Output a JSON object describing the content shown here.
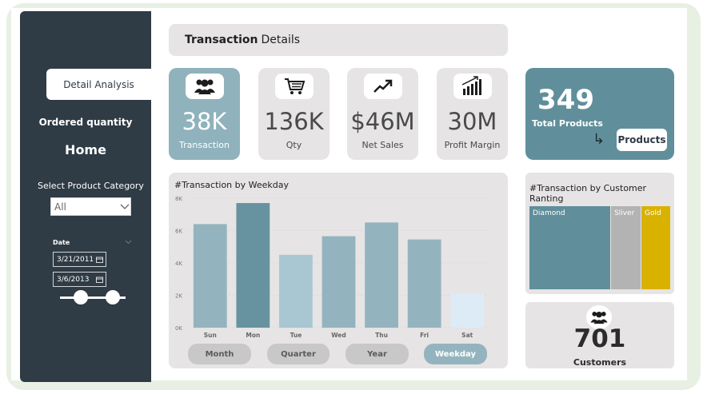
{
  "sidebar": {
    "nav_active": "Detail Analysis",
    "nav_ordered": "Ordered quantity",
    "nav_home": "Home",
    "category_label": "Select Product Category",
    "category_value": "All",
    "date_label": "Date",
    "date_start": "3/21/2011",
    "date_end": "3/6/2013"
  },
  "header": {
    "title_bold": "Transaction",
    "title_rest": "Details"
  },
  "kpis": [
    {
      "value": "38K",
      "label": "Transaction",
      "icon": "people-icon"
    },
    {
      "value": "136K",
      "label": "Qty",
      "icon": "cart-icon"
    },
    {
      "value": "$46M",
      "label": "Net Sales",
      "icon": "trend-up-icon"
    },
    {
      "value": "30M",
      "label": "Profit Margin",
      "icon": "bar-growth-icon"
    }
  ],
  "products": {
    "value": "349",
    "label": "Total Products",
    "button": "Products"
  },
  "weekday_chart": {
    "title": "#Transaction by Weekday",
    "tabs": [
      "Month",
      "Quarter",
      "Year",
      "Weekday"
    ],
    "active_tab": "Weekday"
  },
  "chart_data": {
    "type": "bar",
    "title": "#Transaction by Weekday",
    "categories": [
      "Sun",
      "Mon",
      "Tue",
      "Wed",
      "Thu",
      "Fri",
      "Sat"
    ],
    "values": [
      6400,
      7700,
      4500,
      5650,
      6500,
      5450,
      2100
    ],
    "colors": [
      "#93b4be",
      "#67929f",
      "#a9c6d3",
      "#93b4be",
      "#93b4be",
      "#93b4be",
      "#ddebf7"
    ],
    "ylim": [
      0,
      8000
    ],
    "yticks": [
      "0K",
      "2K",
      "4K",
      "6K",
      "8K"
    ],
    "grid": true
  },
  "treemap": {
    "title_line1": "#Transaction by Customer",
    "title_line2": "Ranting",
    "cells": [
      {
        "label": "Diamond",
        "color": "#608f9b"
      },
      {
        "label": "Sliver",
        "color": "#b3b3b3"
      },
      {
        "label": "Gold",
        "color": "#d9b200"
      }
    ]
  },
  "customers": {
    "value": "701",
    "label": "Customers"
  }
}
